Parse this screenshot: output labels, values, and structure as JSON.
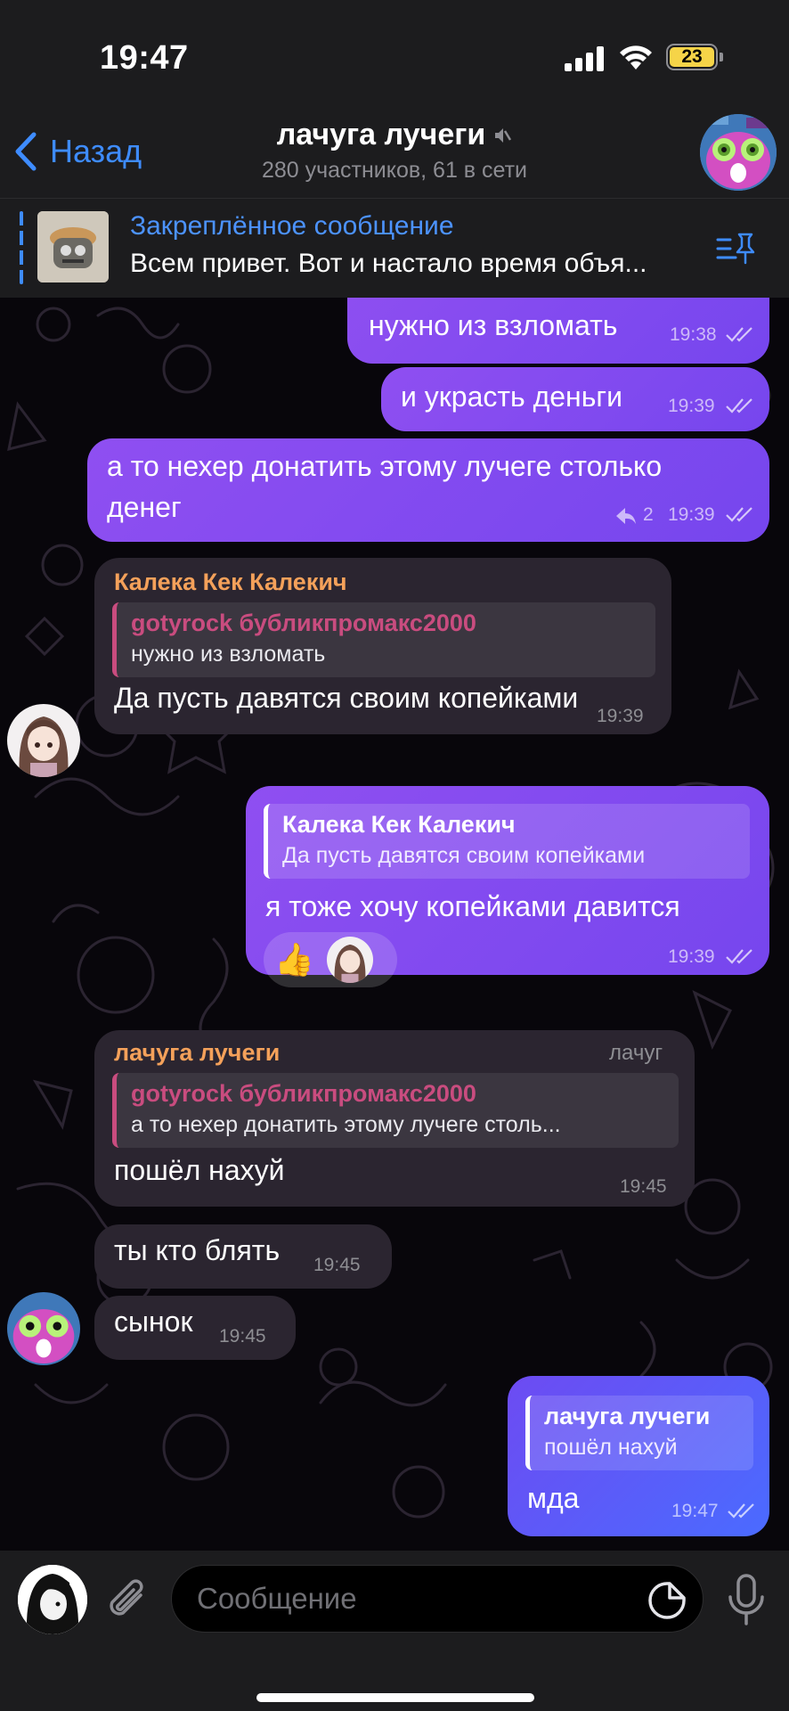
{
  "status_bar": {
    "time": "19:47",
    "battery": "23"
  },
  "header": {
    "back_label": "Назад",
    "title": "лачуга лучеги",
    "subtitle": "280 участников, 61 в сети"
  },
  "pinned": {
    "title": "Закреплённое сообщение",
    "text": "Всем привет. Вот и настало время объя..."
  },
  "messages": {
    "m1": {
      "text": "нужно из взломать",
      "time": "19:38"
    },
    "m2": {
      "text": "и украсть деньги",
      "time": "19:39"
    },
    "m3": {
      "line1": "а то нехер донатить этому лучеге столько",
      "line2": "денег",
      "replies": "2",
      "time": "19:39"
    },
    "m4": {
      "sender": "Калека Кек Калекич",
      "reply_name": "gotyrock бубликпромакс2000",
      "reply_text": "нужно из взломать",
      "text": "Да пусть давятся своим копейками",
      "time": "19:39"
    },
    "m5": {
      "reply_name": "Калека Кек Калекич",
      "reply_text": "Да пусть давятся своим копейками",
      "text": "я тоже хочу копейками давится",
      "reaction": "👍",
      "time": "19:39"
    },
    "m6": {
      "sender": "лачуга лучеги",
      "badge": "лачуг",
      "reply_name": "gotyrock бубликпромакс2000",
      "reply_text": "а то нехер донатить этому лучеге столь...",
      "text": "пошёл нахуй",
      "time": "19:45"
    },
    "m7": {
      "text": "ты кто блять",
      "time": "19:45"
    },
    "m8": {
      "text": "сынок",
      "time": "19:45"
    },
    "m9": {
      "reply_name": "лачуга лучеги",
      "reply_text": "пошёл нахуй",
      "text": "мда",
      "time": "19:47"
    }
  },
  "input": {
    "placeholder": "Сообщение"
  },
  "colors": {
    "outgoing": "#8a4ff0",
    "outgoing_last": "#4a6bff",
    "incoming": "#2b2530",
    "accent": "#3e8cff",
    "sender_name": "#f4a15a",
    "reply_name": "#c94c7f"
  }
}
